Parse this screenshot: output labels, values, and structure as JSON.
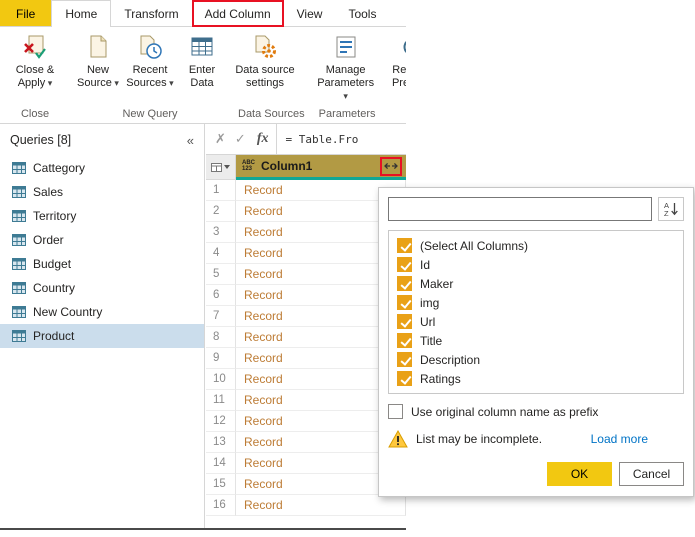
{
  "colors": {
    "accent_yellow": "#F2C811",
    "annotation_red": "#E81123",
    "column_header_olive": "#B29A44",
    "column_header_teal": "#12A795",
    "record_text": "#BD7C35",
    "checkbox_amber": "#E9A117",
    "link_blue": "#0073C6",
    "selected_query_bg": "#CBDDEC"
  },
  "tabbar": {
    "file": "File",
    "tabs": [
      "Home",
      "Transform",
      "Add Column",
      "View",
      "Tools"
    ]
  },
  "ribbon": {
    "buttons": {
      "close_apply": {
        "line1": "Close &",
        "line2": "Apply"
      },
      "new_source": {
        "line1": "New",
        "line2": "Source"
      },
      "recent_sources": {
        "line1": "Recent",
        "line2": "Sources"
      },
      "enter_data": {
        "line1": "Enter",
        "line2": "Data"
      },
      "data_source_settings": {
        "line1": "Data source",
        "line2": "settings"
      },
      "manage_parameters": {
        "line1": "Manage",
        "line2": "Parameters"
      },
      "refresh_preview": {
        "line1": "Refresh",
        "line2": "Preview"
      }
    },
    "groups": {
      "close": "Close",
      "new_query": "New Query",
      "data_sources": "Data Sources",
      "parameters": "Parameters"
    }
  },
  "sidebar": {
    "title": "Queries [8]",
    "items": [
      {
        "label": "Cattegory"
      },
      {
        "label": "Sales"
      },
      {
        "label": "Territory"
      },
      {
        "label": "Order"
      },
      {
        "label": "Budget"
      },
      {
        "label": "Country"
      },
      {
        "label": "New Country"
      },
      {
        "label": "Product",
        "selected": true
      }
    ]
  },
  "formula_bar": {
    "cancel_icon": "✗",
    "commit_icon": "✓",
    "fx_icon": "fx",
    "formula": "= Table.Fro"
  },
  "grid": {
    "column": {
      "type_line1": "ABC",
      "type_line2": "123",
      "name": "Column1"
    },
    "rows": [
      {
        "n": "1",
        "value": "Record"
      },
      {
        "n": "2",
        "value": "Record"
      },
      {
        "n": "3",
        "value": "Record"
      },
      {
        "n": "4",
        "value": "Record"
      },
      {
        "n": "5",
        "value": "Record"
      },
      {
        "n": "6",
        "value": "Record"
      },
      {
        "n": "7",
        "value": "Record"
      },
      {
        "n": "8",
        "value": "Record"
      },
      {
        "n": "9",
        "value": "Record"
      },
      {
        "n": "10",
        "value": "Record"
      },
      {
        "n": "11",
        "value": "Record"
      },
      {
        "n": "12",
        "value": "Record"
      },
      {
        "n": "13",
        "value": "Record"
      },
      {
        "n": "14",
        "value": "Record"
      },
      {
        "n": "15",
        "value": "Record"
      },
      {
        "n": "16",
        "value": "Record"
      }
    ]
  },
  "expand_popup": {
    "search_value": "",
    "options": [
      {
        "label": "(Select All Columns)",
        "checked": true
      },
      {
        "label": "Id",
        "checked": true
      },
      {
        "label": "Maker",
        "checked": true
      },
      {
        "label": "img",
        "checked": true
      },
      {
        "label": "Url",
        "checked": true
      },
      {
        "label": "Title",
        "checked": true
      },
      {
        "label": "Description",
        "checked": true
      },
      {
        "label": "Ratings",
        "checked": true
      }
    ],
    "prefix_label": "Use original column name as prefix",
    "prefix_checked": false,
    "warning": "List may be incomplete.",
    "load_more": "Load more",
    "ok": "OK",
    "cancel": "Cancel"
  }
}
